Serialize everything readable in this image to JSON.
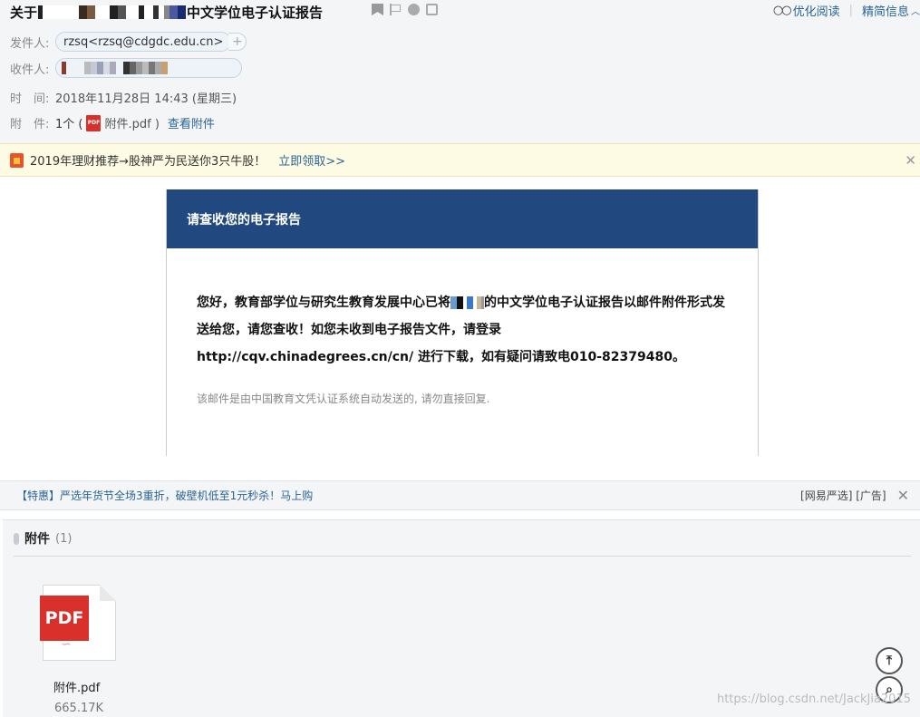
{
  "header": {
    "subject_prefix": "关于",
    "subject_suffix": "中文学位电子认证报告",
    "read_mode_label": "优化阅读",
    "separator": "|",
    "simplified_info_label": "精简信息",
    "sender_label": "发件人:",
    "sender_value": "rzsq<rzsq@cdgdc.edu.cn>",
    "add_sender": "+",
    "recipient_label": "收件人:",
    "time_label": "时　间:",
    "time_value": "2018年11月28日 14:43 (星期三)",
    "attach_label": "附　件:",
    "attach_count": "1个 (",
    "attach_file": "附件.pdf )",
    "view_attach": "查看附件"
  },
  "promo": {
    "text": "2019年理财推荐→股神严为民送你3只牛股！",
    "link": "立即领取>>",
    "close": "✕"
  },
  "email": {
    "heading": "请查收您的电子报告",
    "para_1a": "您好，教育部学位与研究生教育发展中心已将",
    "para_1b": "的中文学位电子认证报告以邮件附件形式发送给您，请您查收！如您未收到电子报告文件，请登录",
    "para_2": "http://cqv.chinadegrees.cn/cn/ 进行下载，如有疑问请致电010-82379480。",
    "note": "该邮件是由中国教育文凭认证系统自动发送的, 请勿直接回复."
  },
  "adbar": {
    "text": "【特惠】严选年货节全场3重折，破壁机低至1元秒杀！马上购",
    "source": "[网易严选] [广告]",
    "close": "✕"
  },
  "attachments": {
    "title": "附件",
    "count": "(1)",
    "file_tag": "PDF",
    "file_name": "附件.pdf",
    "file_size": "665.17K"
  },
  "watermark": "https://blog.csdn.net/JackJia2015",
  "colors": {
    "accent_blue": "#2a6496",
    "email_header": "#21497f",
    "pdf_red": "#d9302c"
  }
}
